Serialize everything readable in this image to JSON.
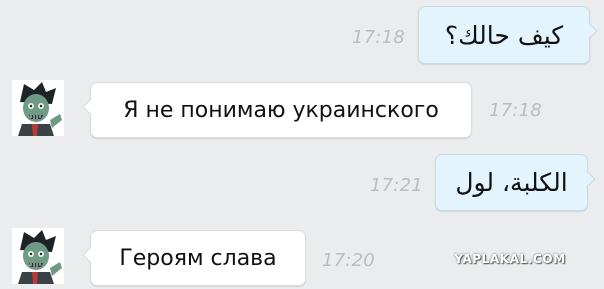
{
  "messages": [
    {
      "direction": "outgoing",
      "text": "كيف حالك؟",
      "time": "17:18"
    },
    {
      "direction": "incoming",
      "text": "Я не понимаю украинского",
      "time": "17:18",
      "avatar_icon": "zombie-avatar-icon"
    },
    {
      "direction": "outgoing",
      "text": "الكلبة، لول",
      "time": "17:21"
    },
    {
      "direction": "incoming",
      "text": "Героям слава",
      "time": "17:20",
      "avatar_icon": "zombie-avatar-icon"
    }
  ],
  "watermark": "YAPLAKAL.COM",
  "colors": {
    "background": "#ebeced",
    "incoming_bubble": "#ffffff",
    "outgoing_bubble": "#e3f4fc",
    "timestamp": "#b9bcc0"
  }
}
